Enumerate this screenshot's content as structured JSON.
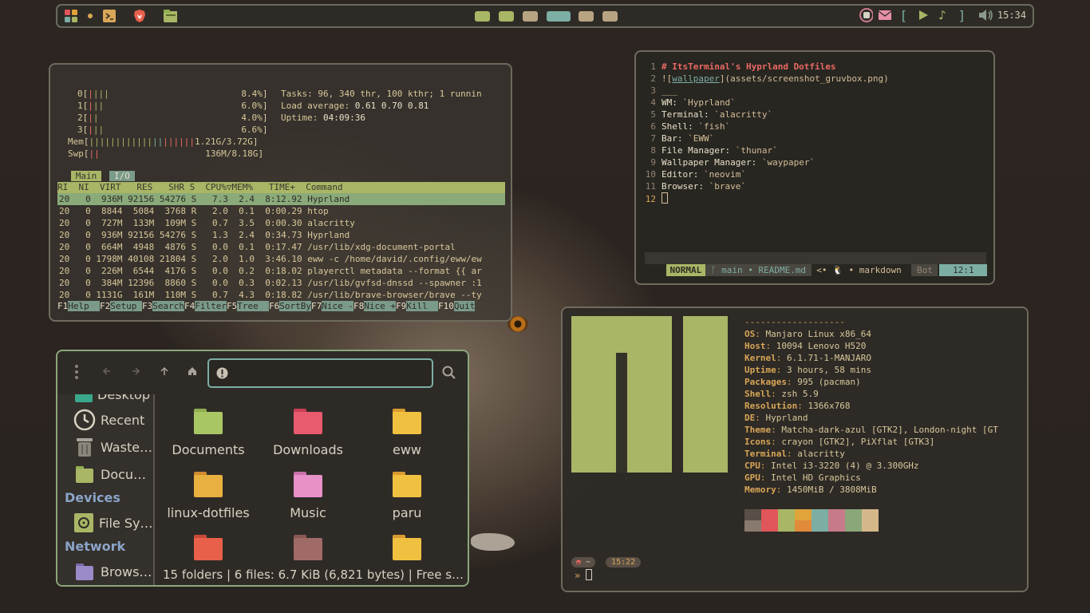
{
  "topbar": {
    "clock": "15:34",
    "workspace_colors": [
      "#a9b665",
      "#a9b665",
      "#b8a383",
      "#7daea3",
      "#b8a383",
      "#b8a383"
    ]
  },
  "htop": {
    "cpus": [
      {
        "id": "0",
        "pct": "8.4%"
      },
      {
        "id": "1",
        "pct": "6.0%"
      },
      {
        "id": "2",
        "pct": "4.0%"
      },
      {
        "id": "3",
        "pct": "6.6%"
      }
    ],
    "mem": {
      "label": "Mem",
      "value": "1.21G/3.72G"
    },
    "swp": {
      "label": "Swp",
      "value": "136M/8.18G"
    },
    "tasks": "Tasks: 96, 340 thr, 100 kthr; 1 runnin",
    "load_label": "Load average:",
    "load_values": "0.61 0.70 0.81",
    "uptime_label": "Uptime:",
    "uptime_value": "04:09:36",
    "tab_main": "Main",
    "tab_io": "I/O",
    "header": "RI  NI  VIRT   RES   SHR S  CPU%▽MEM%   TIME+  Command",
    "rows": [
      "20   0  936M 92156 54276 S   7.3  2.4  8:12.92 Hyprland",
      "20   0  8844  5084  3768 R   2.0  0.1  0:00.29 htop",
      "20   0  727M  133M  109M S   0.7  3.5  0:00.30 alacritty",
      "20   0  936M 92156 54276 S   1.3  2.4  0:34.73 Hyprland",
      "20   0  664M  4948  4876 S   0.0  0.1  0:17.47 /usr/lib/xdg-document-portal",
      "20   0 1798M 40108 21804 S   2.0  1.0  3:46.10 eww -c /home/david/.config/eww/ew",
      "20   0  226M  6544  4176 S   0.0  0.2  0:18.02 playerctl metadata --format {{ ar",
      "20   0  384M 12396  8860 S   0.0  0.3  0:02.13 /usr/lib/gvfsd-dnssd --spawner :1",
      "20   0 1131G  161M  110M S   0.7  4.3  0:18.82 /usr/lib/brave-browser/brave --ty"
    ],
    "fkeys": [
      {
        "k": "F1",
        "l": "Help  "
      },
      {
        "k": "F2",
        "l": "Setup "
      },
      {
        "k": "F3",
        "l": "Search"
      },
      {
        "k": "F4",
        "l": "Filter"
      },
      {
        "k": "F5",
        "l": "Tree  "
      },
      {
        "k": "F6",
        "l": "SortBy"
      },
      {
        "k": "F7",
        "l": "Nice -"
      },
      {
        "k": "F8",
        "l": "Nice +"
      },
      {
        "k": "F9",
        "l": "Kill  "
      },
      {
        "k": "F10",
        "l": "Quit"
      }
    ]
  },
  "nvim": {
    "lines": [
      {
        "n": "1",
        "t": "# ItsTerminal's Hyprland Dotfiles"
      },
      {
        "n": "2",
        "t": "![wallpaper](assets/screenshot_gruvbox.png)"
      },
      {
        "n": "3",
        "t": "___"
      },
      {
        "n": "4",
        "t": "WM: `Hyprland`"
      },
      {
        "n": "5",
        "t": "Terminal: `alacritty`"
      },
      {
        "n": "6",
        "t": "Shell: `fish`"
      },
      {
        "n": "7",
        "t": "Bar: `EWW`"
      },
      {
        "n": "8",
        "t": "File Manager: `thunar`"
      },
      {
        "n": "9",
        "t": "Wallpaper Manager: `waypaper`"
      },
      {
        "n": "10",
        "t": "Editor: `neovim`"
      },
      {
        "n": "11",
        "t": "Browser: `brave`"
      },
      {
        "n": "12",
        "t": ""
      }
    ],
    "status": {
      "mode": "NORMAL",
      "branch": " ᚴ main • README.md ",
      "ft": " <• 🐧 • markdown ",
      "pos": " Bot ",
      "loc": " 12:1 "
    }
  },
  "fm": {
    "path_value": "",
    "sidebar": [
      {
        "label": "Desktop",
        "icon": "desktop-folder-icon",
        "color": "#3aa88a"
      },
      {
        "label": "Recent",
        "icon": "clock-icon",
        "color": "#d8d2c2"
      },
      {
        "label": "Waste…",
        "icon": "trash-icon",
        "color": "#a8a39a"
      },
      {
        "label": "Docu…",
        "icon": "documents-folder-icon",
        "color": "#a9b665"
      }
    ],
    "section_devices": "Devices",
    "device": "File Sy…",
    "section_network": "Network",
    "network": "Brows…",
    "folders": [
      {
        "label": "Documents",
        "color": "#a9c665",
        "tab": "#8fae50"
      },
      {
        "label": "Downloads",
        "color": "#e85a6e",
        "tab": "#c94056"
      },
      {
        "label": "eww",
        "color": "#f0c040",
        "tab": "#d89a30"
      },
      {
        "label": "linux-dotfiles",
        "color": "#e8b040",
        "tab": "#d08a30"
      },
      {
        "label": "Music",
        "color": "#e890c8",
        "tab": "#c870a8"
      },
      {
        "label": "paru",
        "color": "#f0c040",
        "tab": "#d89a30"
      },
      {
        "label": "",
        "color": "#e8604a",
        "tab": "#c84a38"
      },
      {
        "label": "",
        "color": "#a06a66",
        "tab": "#8a5854"
      },
      {
        "label": "",
        "color": "#f0c040",
        "tab": "#d89a30"
      }
    ],
    "status": "15 folders  |  6 files: 6.7 KiB (6,821 bytes)  |  Free s…"
  },
  "neofetch": {
    "sep": "-------------------",
    "info": [
      {
        "k": "OS",
        "v": "Manjaro Linux x86_64"
      },
      {
        "k": "Host",
        "v": "10094 Lenovo H520"
      },
      {
        "k": "Kernel",
        "v": "6.1.71-1-MANJARO"
      },
      {
        "k": "Uptime",
        "v": "3 hours, 58 mins"
      },
      {
        "k": "Packages",
        "v": "995 (pacman)"
      },
      {
        "k": "Shell",
        "v": "zsh 5.9"
      },
      {
        "k": "Resolution",
        "v": "1366x768"
      },
      {
        "k": "DE",
        "v": "Hyprland"
      },
      {
        "k": "Theme",
        "v": "Matcha-dark-azul [GTK2], London-night [GT"
      },
      {
        "k": "Icons",
        "v": "crayon [GTK2], PiXflat [GTK3]"
      },
      {
        "k": "Terminal",
        "v": "alacritty"
      },
      {
        "k": "CPU",
        "v": "Intel i3-3220 (4) @ 3.300GHz"
      },
      {
        "k": "GPU",
        "v": "Intel HD Graphics"
      },
      {
        "k": "Memory",
        "v": "1450MiB / 3808MiB"
      }
    ],
    "swatches_top": [
      "#5a4f46",
      "#e0565a",
      "#a9b665",
      "#e0a43a",
      "#7daea3",
      "#c77a8a",
      "#8aa77a",
      "#d4b88a"
    ],
    "swatches_bottom": [
      "#8a7a6e",
      "#e0565a",
      "#a9b665",
      "#e08a3a",
      "#7daea3",
      "#c77a8a",
      "#8aa77a",
      "#d4b88a"
    ],
    "prompt_dir": "~",
    "prompt_time": "15:22",
    "prompt_arrow": "»"
  }
}
